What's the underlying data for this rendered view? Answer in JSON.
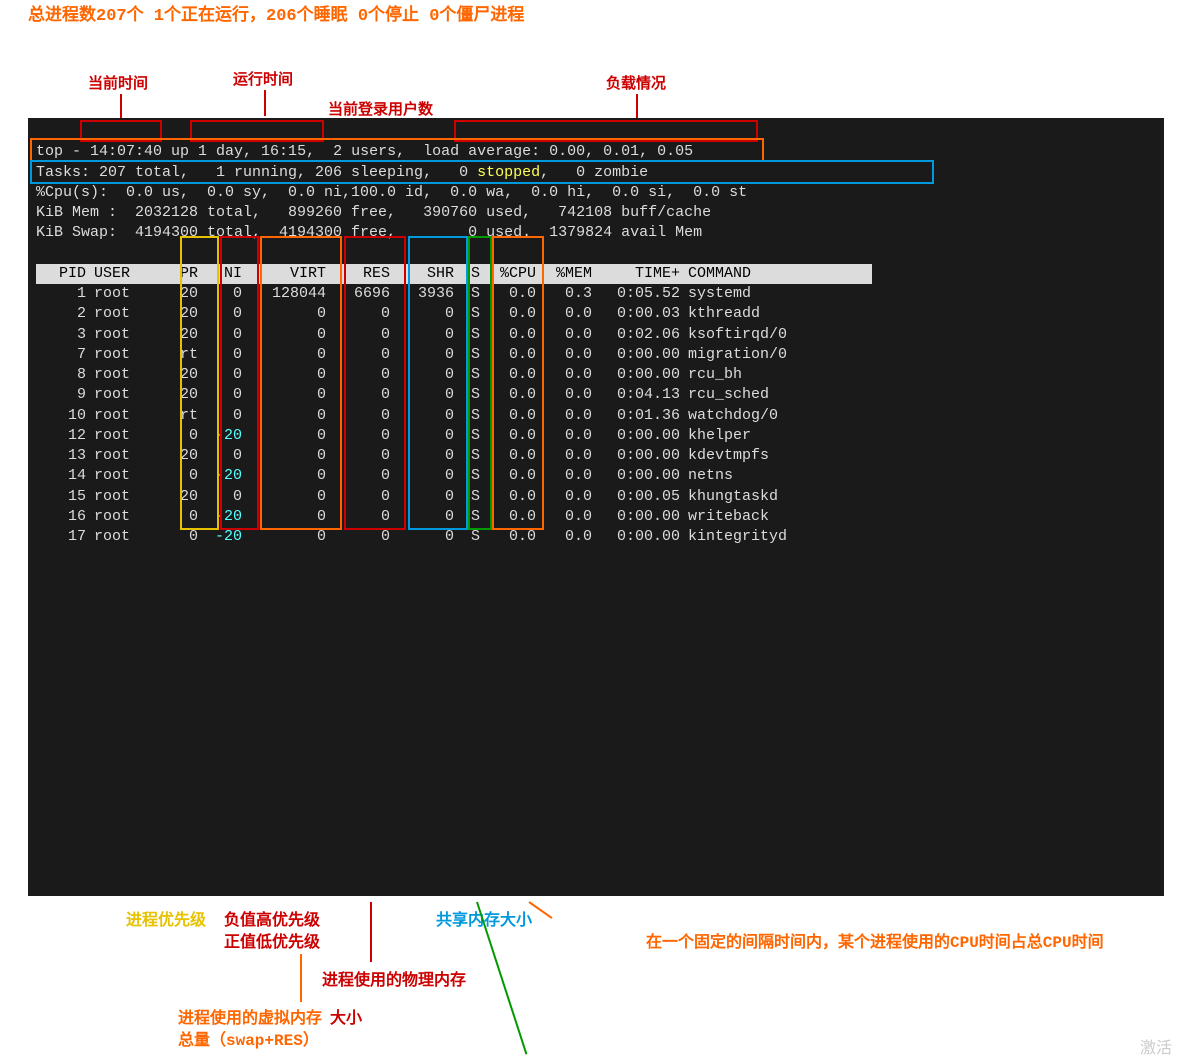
{
  "anno_top": "总进程数207个  1个正在运行，206个睡眠  0个停止  0个僵尸进程",
  "labels": {
    "cur_time": "当前时间",
    "run_time": "运行时间",
    "login_users": "当前登录用户数",
    "load": "负载情况"
  },
  "term": {
    "line1_a": "top - ",
    "line1_time": "14:07:40",
    "line1_b": " up ",
    "line1_up": "1 day, 16:15",
    "line1_c": ",  ",
    "line1_users": "2 users",
    "line1_d": ",  ",
    "line1_load_lbl": "load average: ",
    "line1_load": "0.00, 0.01, 0.05",
    "tasks": "Tasks: 207 total,   1 running, 206 sleeping,   0 ",
    "tasks_stopped": "stopped",
    "tasks_tail": ",   0 zombie",
    "cpu": "%Cpu(s):  0.0 us,  0.0 sy,  0.0 ni,100.0 id,  0.0 wa,  0.0 hi,  0.0 si,  0.0 st",
    "mem": "KiB Mem :  2032128 total,   899260 free,   390760 used,   742108 buff/cache",
    "swap": "KiB Swap:  4194300 total,  4194300 free,        0 used.  1379824 avail Mem"
  },
  "cols": [
    "PID",
    "USER",
    "PR",
    "NI",
    "VIRT",
    "RES",
    "SHR",
    "S",
    "%CPU",
    "%MEM",
    "TIME+",
    "COMMAND"
  ],
  "rows": [
    {
      "pid": "1",
      "user": "root",
      "pr": "20",
      "ni": "0",
      "virt": "128044",
      "res": "6696",
      "shr": "3936",
      "s": "S",
      "cpu": "0.0",
      "mem": "0.3",
      "time": "0:05.52",
      "cmd": "systemd"
    },
    {
      "pid": "2",
      "user": "root",
      "pr": "20",
      "ni": "0",
      "virt": "0",
      "res": "0",
      "shr": "0",
      "s": "S",
      "cpu": "0.0",
      "mem": "0.0",
      "time": "0:00.03",
      "cmd": "kthreadd"
    },
    {
      "pid": "3",
      "user": "root",
      "pr": "20",
      "ni": "0",
      "virt": "0",
      "res": "0",
      "shr": "0",
      "s": "S",
      "cpu": "0.0",
      "mem": "0.0",
      "time": "0:02.06",
      "cmd": "ksoftirqd/0"
    },
    {
      "pid": "7",
      "user": "root",
      "pr": "rt",
      "ni": "0",
      "virt": "0",
      "res": "0",
      "shr": "0",
      "s": "S",
      "cpu": "0.0",
      "mem": "0.0",
      "time": "0:00.00",
      "cmd": "migration/0"
    },
    {
      "pid": "8",
      "user": "root",
      "pr": "20",
      "ni": "0",
      "virt": "0",
      "res": "0",
      "shr": "0",
      "s": "S",
      "cpu": "0.0",
      "mem": "0.0",
      "time": "0:00.00",
      "cmd": "rcu_bh"
    },
    {
      "pid": "9",
      "user": "root",
      "pr": "20",
      "ni": "0",
      "virt": "0",
      "res": "0",
      "shr": "0",
      "s": "S",
      "cpu": "0.0",
      "mem": "0.0",
      "time": "0:04.13",
      "cmd": "rcu_sched"
    },
    {
      "pid": "10",
      "user": "root",
      "pr": "rt",
      "ni": "0",
      "virt": "0",
      "res": "0",
      "shr": "0",
      "s": "S",
      "cpu": "0.0",
      "mem": "0.0",
      "time": "0:01.36",
      "cmd": "watchdog/0"
    },
    {
      "pid": "12",
      "user": "root",
      "pr": "0",
      "ni": "-20",
      "virt": "0",
      "res": "0",
      "shr": "0",
      "s": "S",
      "cpu": "0.0",
      "mem": "0.0",
      "time": "0:00.00",
      "cmd": "khelper"
    },
    {
      "pid": "13",
      "user": "root",
      "pr": "20",
      "ni": "0",
      "virt": "0",
      "res": "0",
      "shr": "0",
      "s": "S",
      "cpu": "0.0",
      "mem": "0.0",
      "time": "0:00.00",
      "cmd": "kdevtmpfs"
    },
    {
      "pid": "14",
      "user": "root",
      "pr": "0",
      "ni": "-20",
      "virt": "0",
      "res": "0",
      "shr": "0",
      "s": "S",
      "cpu": "0.0",
      "mem": "0.0",
      "time": "0:00.00",
      "cmd": "netns"
    },
    {
      "pid": "15",
      "user": "root",
      "pr": "20",
      "ni": "0",
      "virt": "0",
      "res": "0",
      "shr": "0",
      "s": "S",
      "cpu": "0.0",
      "mem": "0.0",
      "time": "0:00.05",
      "cmd": "khungtaskd"
    },
    {
      "pid": "16",
      "user": "root",
      "pr": "0",
      "ni": "-20",
      "virt": "0",
      "res": "0",
      "shr": "0",
      "s": "S",
      "cpu": "0.0",
      "mem": "0.0",
      "time": "0:00.00",
      "cmd": "writeback"
    },
    {
      "pid": "17",
      "user": "root",
      "pr": "0",
      "ni": "-20",
      "virt": "0",
      "res": "0",
      "shr": "0",
      "s": "S",
      "cpu": "0.0",
      "mem": "0.0",
      "time": "0:00.00",
      "cmd": "kintegrityd"
    }
  ],
  "bottom": {
    "pr": "进程优先级",
    "ni1": "负值高优先级",
    "ni2": "正值低优先级",
    "shr": "共享内存大小",
    "cpu": "在一个固定的间隔时间内，某个进程使用的CPU时间占总CPU时间",
    "res1": "进程使用的物理内存",
    "res2": "大小",
    "virt1": "进程使用的虚拟内存",
    "virt2": "总量（swap+RES）"
  },
  "watermark": "激活"
}
